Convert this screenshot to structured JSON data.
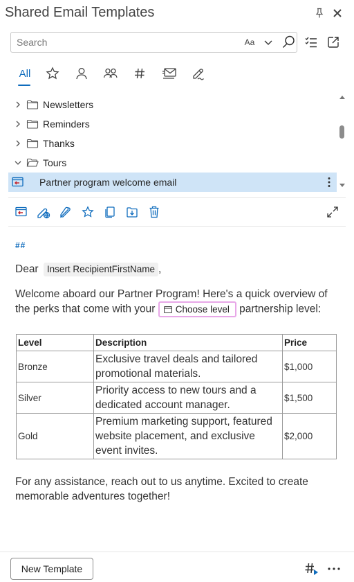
{
  "header": {
    "title": "Shared Email Templates"
  },
  "search": {
    "placeholder": "Search",
    "value": "",
    "case_label": "Aa"
  },
  "tabs": [
    {
      "label": "All",
      "icon": "all",
      "active": true
    },
    {
      "icon": "star-icon"
    },
    {
      "icon": "person-icon"
    },
    {
      "icon": "people-icon"
    },
    {
      "icon": "hashtag-icon"
    },
    {
      "icon": "envelope-icon"
    },
    {
      "icon": "pen-signature-icon"
    }
  ],
  "tree": {
    "items": [
      {
        "label": "Newsletters",
        "expanded": false
      },
      {
        "label": "Reminders",
        "expanded": false
      },
      {
        "label": "Thanks",
        "expanded": false
      },
      {
        "label": "Tours",
        "expanded": true
      },
      {
        "label": "Partner program welcome email",
        "selected": true
      }
    ]
  },
  "preview": {
    "hash_marker": "##",
    "greeting": "Dear",
    "recipient_field": "Insert RecipientFirstName",
    "greeting_comma": ",",
    "intro_before": "Welcome aboard our Partner Program! Here's a quick overview of the perks that come with your",
    "level_field": "Choose level",
    "intro_after": "partnership level:",
    "table": {
      "headers": [
        "Level",
        "Description",
        "Price"
      ],
      "rows": [
        [
          "Bronze",
          "Exclusive travel deals and tailored promotional materials.",
          "$1,000"
        ],
        [
          "Silver",
          "Priority access to new tours and a dedicated account manager.",
          "$1,500"
        ],
        [
          "Gold",
          "Premium marketing support, featured website placement, and exclusive event invites.",
          "$2,000"
        ]
      ]
    },
    "closing": "For any assistance, reach out to us anytime. Excited to create memorable adventures together!"
  },
  "footer": {
    "new_template_label": "New Template",
    "hash_label": "##"
  },
  "colors": {
    "accent": "#0f6cbd",
    "selected_row": "#cfe4f7",
    "field_highlight_border": "#e8a7e8",
    "template_icon_red": "#c4262e"
  }
}
